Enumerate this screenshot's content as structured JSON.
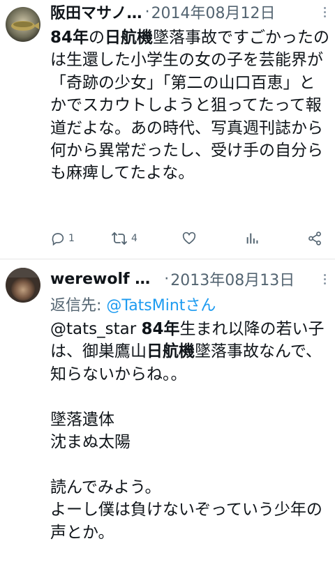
{
  "tweets": [
    {
      "display_name": "阪田マサノ…",
      "separator": "·",
      "date": "2014年08月12日",
      "body": [
        {
          "text": "84年",
          "bold": true
        },
        {
          "text": "の",
          "bold": false
        },
        {
          "text": "日航機",
          "bold": true
        },
        {
          "text": "墜落事故ですごかったのは生還した小学生の女の子を芸能界が「奇跡の少女」「第二の山口百恵」とかでスカウトしようと狙ってたって報道だよな。あの時代、写真週刊誌から何から異常だったし、受け手の自分らも麻痺してたよな。",
          "bold": false
        }
      ],
      "actions": {
        "reply_count": "1",
        "retweet_count": "4"
      }
    },
    {
      "display_name": "werewolf …",
      "separator": "·",
      "date": "2013年08月13日",
      "reply_label": "返信先: ",
      "reply_handle": "@TatsMintさん",
      "body": [
        {
          "text": "@tats_star ",
          "bold": false
        },
        {
          "text": "84年",
          "bold": true
        },
        {
          "text": "生まれ以降の若い子は、御巣鷹山",
          "bold": false
        },
        {
          "text": "日航機",
          "bold": true
        },
        {
          "text": "墜落事故なんで、知らないからね。。\n\n墜落遺体\n沈まぬ太陽\n\n読んでみよう。\nよーし僕は負けないぞっていう少年の声とか。",
          "bold": false
        }
      ]
    }
  ],
  "colors": {
    "text": "#0f1419",
    "secondary": "#536471",
    "link": "#1d9bf0",
    "divider": "#e6e6e6"
  },
  "icons": [
    "reply-icon",
    "retweet-icon",
    "like-icon",
    "analytics-icon",
    "share-icon",
    "more-icon"
  ]
}
